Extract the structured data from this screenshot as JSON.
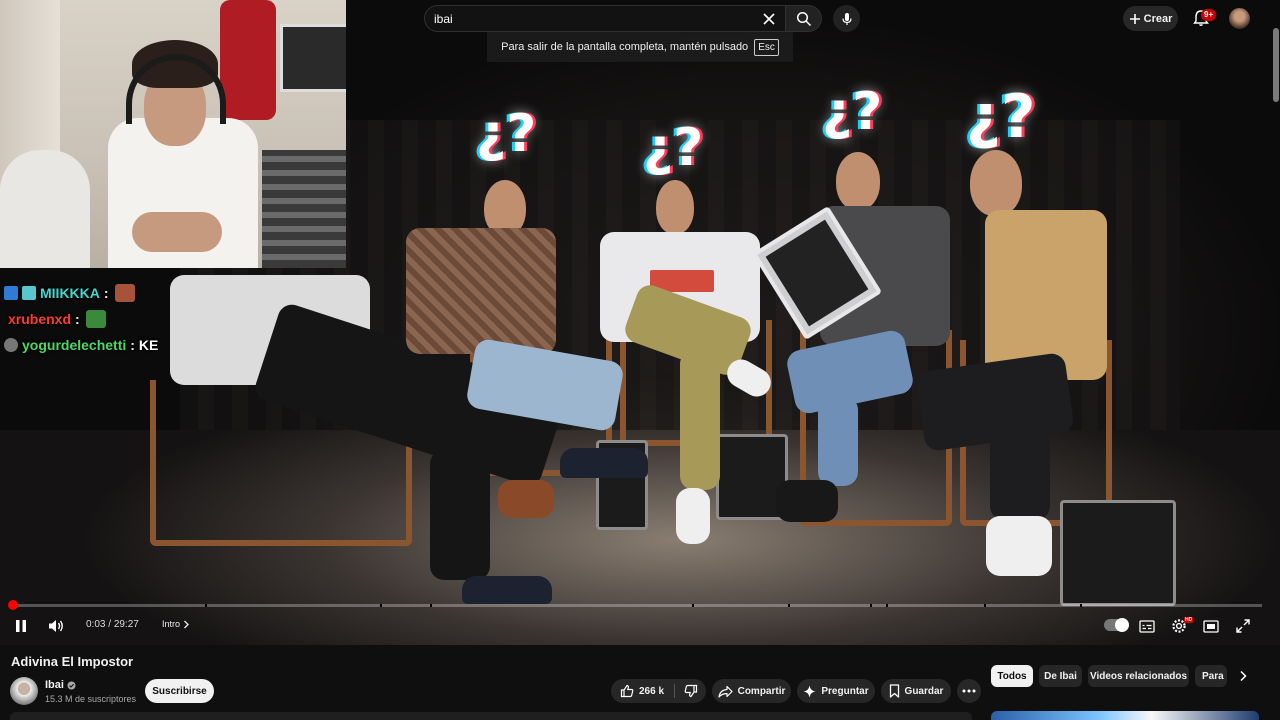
{
  "search": {
    "query": "ibai"
  },
  "fullscreen_notice": {
    "text": "Para salir de la pantalla completa, mantén pulsado",
    "key": "Esc"
  },
  "header": {
    "create_label": "Crear",
    "notifications_count": "9+"
  },
  "chat": [
    {
      "user": "MIIKKKA",
      "separator": ":",
      "message": "",
      "user_color": "#3fd7d1"
    },
    {
      "user": "xrubenxd",
      "separator": ":",
      "message": "",
      "user_color": "#ff3b30"
    },
    {
      "user": "yogurdelechetti",
      "separator": ":",
      "message": "KE",
      "user_color": "#4cd964"
    }
  ],
  "player": {
    "current_time": "0:03",
    "duration": "29:27",
    "time_separator": "/",
    "chapter": "Intro",
    "progress_fraction": 0.0017,
    "hd_badge": "HD"
  },
  "video": {
    "title": "Adivina El Impostor",
    "channel_name": "Ibai",
    "subscribers": "15.3 M de suscriptores",
    "subscribe_label": "Suscribirse",
    "likes": "266 k",
    "share_label": "Compartir",
    "ask_label": "Preguntar",
    "save_label": "Guardar"
  },
  "chips": [
    "Todos",
    "De Ibai",
    "Videos relacionados",
    "Para"
  ],
  "colors": {
    "accent_red": "#ff0000",
    "background": "#0f0f0f",
    "pill": "#272727"
  },
  "icons": [
    "clear-icon",
    "search-icon",
    "mic-icon",
    "plus-icon",
    "bell-icon",
    "pause-icon",
    "volume-icon",
    "chevron-right-icon",
    "autoplay-toggle",
    "subtitles-icon",
    "settings-icon",
    "miniplayer-icon",
    "exit-fullscreen-icon",
    "verified-icon",
    "thumbs-up-icon",
    "thumbs-down-icon",
    "share-icon",
    "sparkle-icon",
    "bookmark-icon",
    "more-icon"
  ]
}
